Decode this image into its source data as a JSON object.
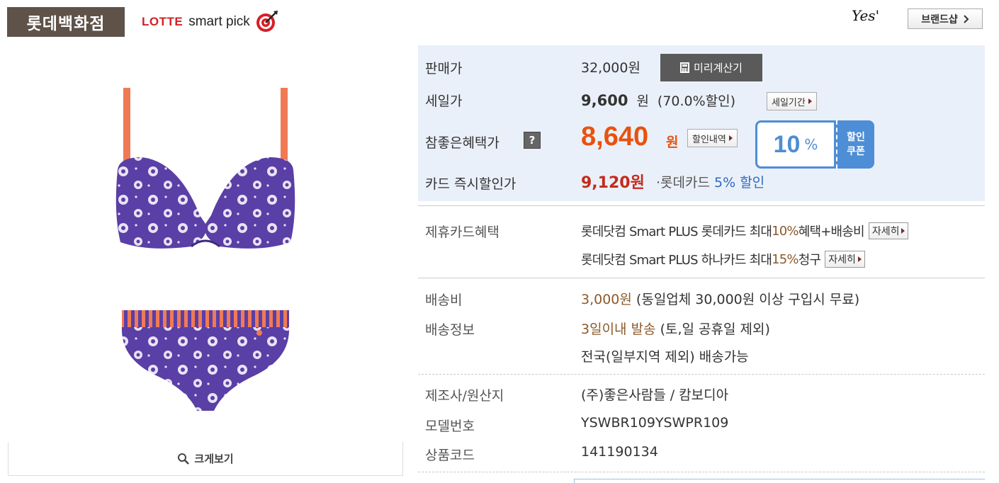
{
  "header": {
    "store_name": "롯데백화점",
    "smartpick_brand": "LOTTE",
    "smartpick_text": "smart pick",
    "yes_logo": "Yes'",
    "brand_shop_button": "브랜드샵"
  },
  "image": {
    "zoom_button": "크게보기",
    "product_colors": {
      "fabric": "#5a3fa6",
      "strap": "#f07a55",
      "dots": "#e9e2f3"
    }
  },
  "price": {
    "list_price_label": "판매가",
    "list_price": "32,000원",
    "calc_button": "미리계산기",
    "sale_label": "세일가",
    "sale_price": "9,600",
    "sale_unit": "원",
    "sale_discount": "(70.0%할인)",
    "sale_period_button": "세일기간",
    "best_label": "참좋은혜택가",
    "best_help": "?",
    "best_price": "8,640",
    "best_unit": "원",
    "discount_detail_button": "할인내역",
    "coupon": {
      "percent": "10",
      "symbol": "%",
      "label_line1": "할인",
      "label_line2": "쿠폰"
    },
    "card_label": "카드 즉시할인가",
    "card_price": "9,120원",
    "card_bullet": "·",
    "card_name": "롯데카드",
    "card_discount": "5% 할인"
  },
  "partner": {
    "label": "제휴카드혜택",
    "line1_prefix": "롯데닷컴 Smart PLUS 롯데카드 최대",
    "line1_pct": "10%",
    "line1_suffix": "혜택+배송비",
    "line2_prefix": "롯데닷컴 Smart PLUS 하나카드 최대",
    "line2_pct": "15%",
    "line2_suffix": "청구",
    "detail_button": "자세히"
  },
  "shipping": {
    "fee_label": "배송비",
    "fee_value": "3,000원",
    "fee_note": "(동일업체 30,000원 이상 구입시 무료)",
    "info_label": "배송정보",
    "info_value": "3일이내 발송",
    "info_note": "(토,일 공휴일 제외)",
    "area": "전국(일부지역 제외) 배송가능"
  },
  "product": {
    "maker_label": "제조사/원산지",
    "maker_value": "(주)좋은사람들 / 캄보디아",
    "model_label": "모델번호",
    "model_value": "YSWBR109YSWPR109",
    "code_label": "상품코드",
    "code_value": "141190134"
  },
  "colors": {
    "accent_orange": "#e8520e",
    "card_red": "#c52a1c",
    "link_blue": "#2b6bbf",
    "coupon_blue": "#4d8ed6",
    "price_box_bg": "#eaf0f9",
    "store_badge_bg": "#5e5249"
  }
}
